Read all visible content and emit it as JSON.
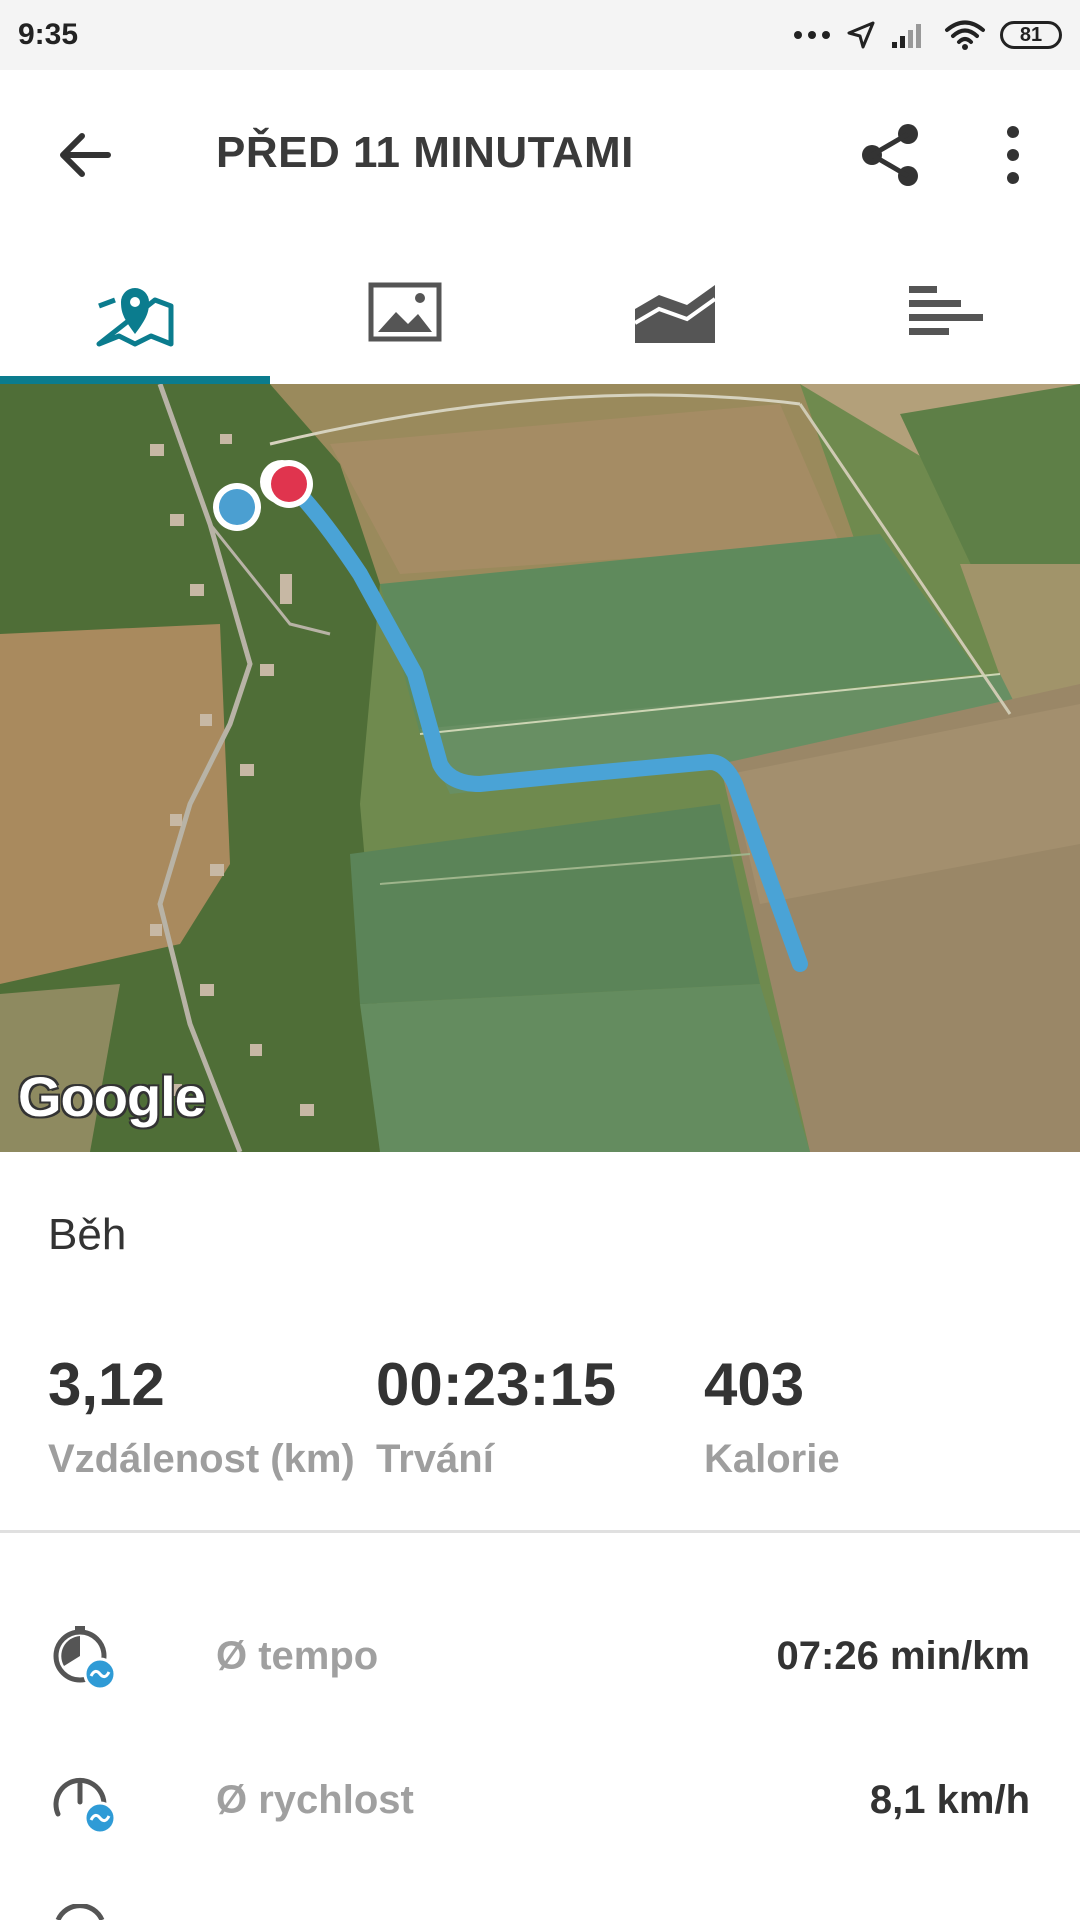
{
  "status_bar": {
    "time": "9:35",
    "battery": "81"
  },
  "header": {
    "title": "PŘED 11 MINUTAMI"
  },
  "tabs": [
    {
      "name": "map",
      "icon": "map-pin-icon",
      "active": true
    },
    {
      "name": "photos",
      "icon": "image-icon",
      "active": false
    },
    {
      "name": "charts",
      "icon": "area-chart-icon",
      "active": false
    },
    {
      "name": "splits",
      "icon": "bars-icon",
      "active": false
    }
  ],
  "map": {
    "attribution": "Google",
    "route_color": "#4aa3d6",
    "start_marker_color": "#4b9fd1",
    "end_marker_color": "#e0344e"
  },
  "activity": {
    "type": "Běh"
  },
  "stats": [
    {
      "value": "3,12",
      "label": "Vzdálenost (km)"
    },
    {
      "value": "00:23:15",
      "label": "Trvání"
    },
    {
      "value": "403",
      "label": "Kalorie"
    }
  ],
  "details": [
    {
      "label": "Ø tempo",
      "value": "07:26 min/km",
      "icon": "timer-avg-icon"
    },
    {
      "label": "Ø rychlost",
      "value": "8,1 km/h",
      "icon": "speedometer-avg-icon"
    }
  ],
  "colors": {
    "accent": "#0b7c8e"
  }
}
